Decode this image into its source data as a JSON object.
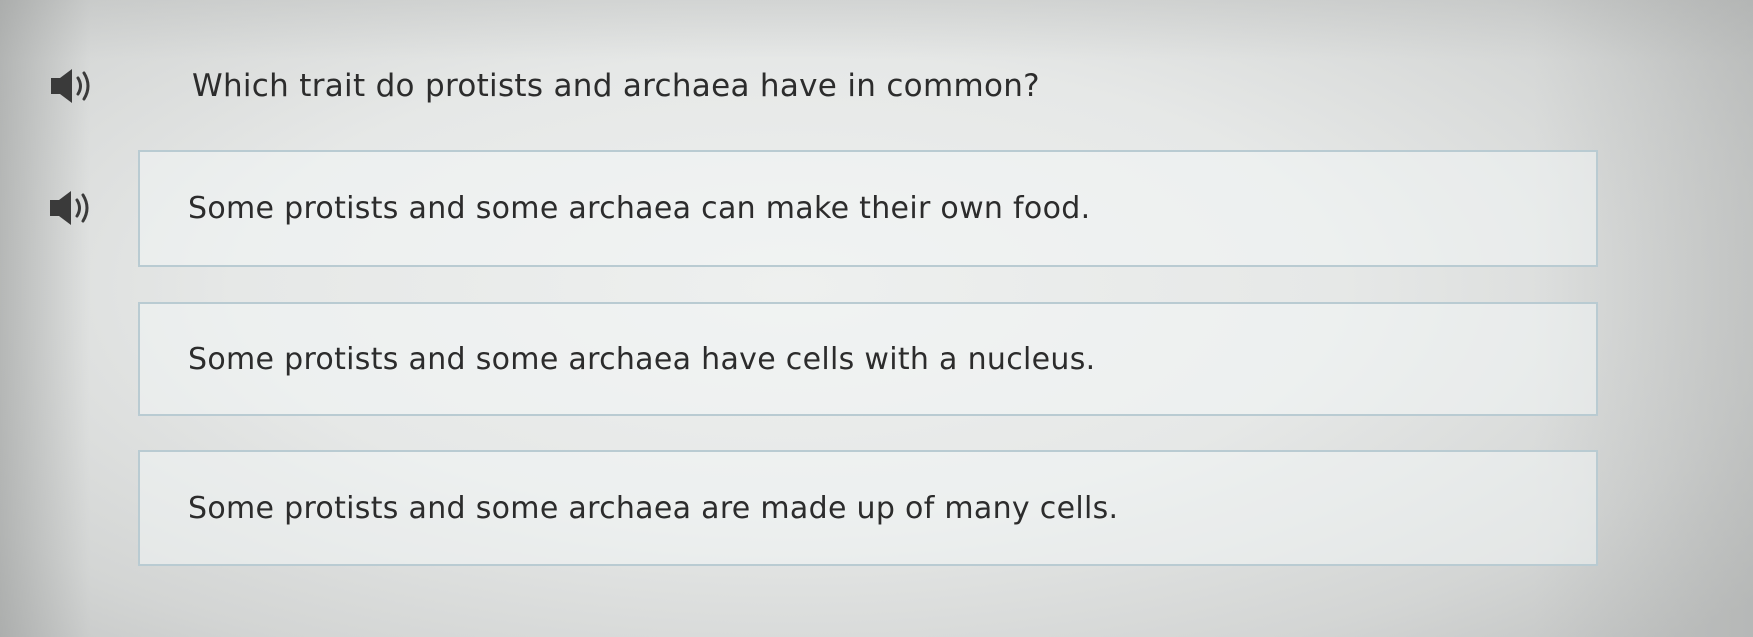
{
  "question": {
    "text": "Which trait do protists and archaea have in common?",
    "icon": "speaker-icon"
  },
  "choices": [
    {
      "label": "Some protists and some archaea can make their own food.",
      "has_audio": true
    },
    {
      "label": "Some protists and some archaea have cells with a nucleus.",
      "has_audio": false
    },
    {
      "label": "Some protists and some archaea are made up of many cells.",
      "has_audio": false
    }
  ],
  "colors": {
    "text": "#2c2c2c",
    "icon": "#3a3a3a",
    "choice_border": "#b9cbd2"
  }
}
